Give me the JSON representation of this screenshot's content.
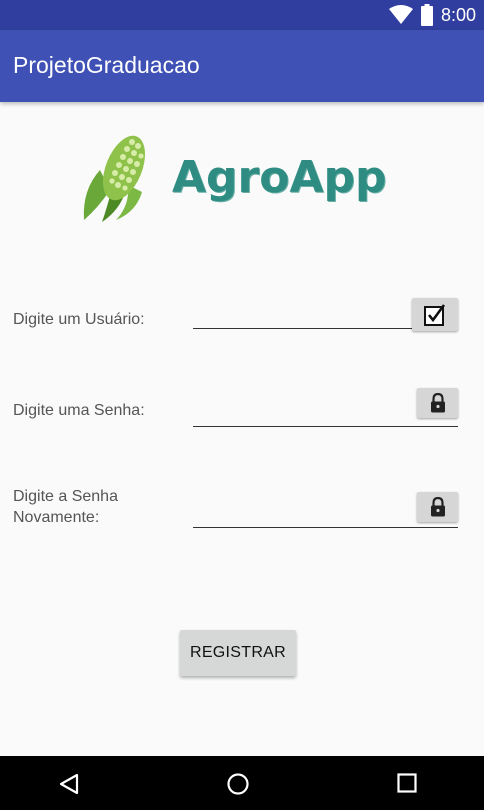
{
  "status_bar": {
    "time": "8:00",
    "icons": [
      "wifi-icon",
      "battery-icon"
    ]
  },
  "app_bar": {
    "title": "ProjetoGraduacao"
  },
  "logo": {
    "text": "AgroApp",
    "icon": "corn-icon"
  },
  "form": {
    "username_label": "Digite um Usuário:",
    "username_value": "",
    "username_icon": "checkbox-checked-icon",
    "password_label": "Digite uma Senha:",
    "password_value": "",
    "password_icon": "lock-icon",
    "confirm_label_line1": "Digite a Senha",
    "confirm_label_line2": "Novamente:",
    "confirm_value": "",
    "confirm_icon": "lock-icon"
  },
  "register_button": {
    "label": "REGISTRAR"
  },
  "nav_bar": {
    "icons": [
      "back-icon",
      "home-icon",
      "recents-icon"
    ]
  },
  "colors": {
    "status_bar": "#303f9f",
    "app_bar": "#3f51b5",
    "logo_text": "#2e8c83",
    "corn_green": "#5a9b2e"
  }
}
